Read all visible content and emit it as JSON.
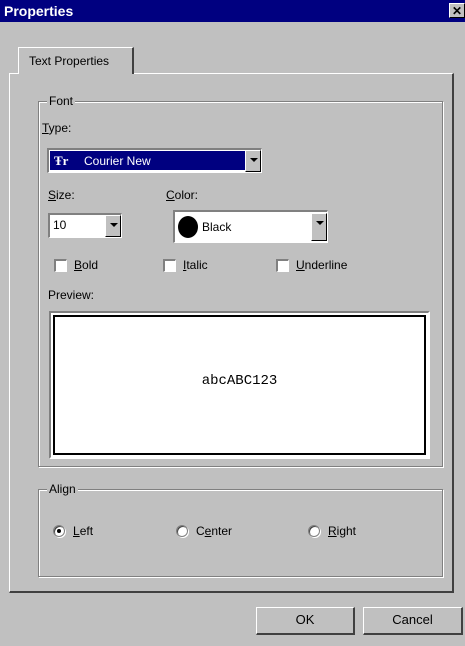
{
  "window": {
    "title": "Properties",
    "close_glyph": "✕"
  },
  "tabs": [
    {
      "label": "Text Properties"
    }
  ],
  "font_group": {
    "title": "Font",
    "type_label_u": "T",
    "type_label_rest": "ype:",
    "type_value": "Courier New",
    "type_icon_glyph": "Ŧr",
    "size_label_u": "S",
    "size_label_rest": "ize:",
    "size_value": "10",
    "color_label_u": "C",
    "color_label_rest": "olor:",
    "color_value": "Black",
    "bold_label_u": "B",
    "bold_label_rest": "old",
    "italic_label_u": "I",
    "italic_label_rest": "talic",
    "underline_label_u": "U",
    "underline_label_rest": "nderline",
    "preview_label": "Preview:",
    "preview_text": "abcABC123"
  },
  "align_group": {
    "title": "Align",
    "left_label_u": "L",
    "left_label_rest": "eft",
    "center_label_pre": "C",
    "center_label_u": "e",
    "center_label_rest": "nter",
    "right_label_u": "R",
    "right_label_rest": "ight",
    "selected": "Left"
  },
  "buttons": {
    "ok": "OK",
    "cancel": "Cancel"
  },
  "colors": {
    "titlebar": "#000080",
    "face": "#c0c0c0",
    "selection": "#000080",
    "swatch": "#000000"
  }
}
